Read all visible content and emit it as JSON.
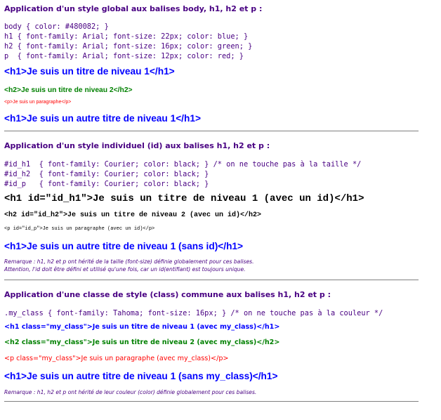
{
  "section1": {
    "title": "Application d'un style global aux balises body, h1, h2 et p :",
    "code": [
      "body { color: #480082; }",
      "h1 { font-family: Arial; font-size: 22px; color: blue; }",
      "h2 { font-family: Arial; font-size: 16px; color: green; }",
      "p  { font-family: Arial; font-size: 12px; color: red; }"
    ],
    "h1_demo": "<h1>Je suis un titre de niveau 1</h1>",
    "h2_demo": "<h2>Je suis un titre de niveau 2</h2>",
    "p_demo": "<p>Je suis un paragraphe</p>",
    "h1_demo2": "<h1>Je suis un autre titre de niveau 1</h1>"
  },
  "section2": {
    "title": "Application d'un style individuel (id) aux balises h1, h2 et p :",
    "code": [
      "#id_h1  { font-family: Courier; color: black; } /* on ne touche pas à la taille */",
      "#id_h2  { font-family: Courier; color: black; }",
      "#id_p   { font-family: Courier; color: black; }"
    ],
    "h1_demo": "<h1 id=\"id_h1\">Je suis un titre de niveau 1 (avec un id)</h1>",
    "h2_demo": "<h2 id=\"id_h2\">Je suis un titre de niveau 2 (avec un id)</h2>",
    "p_demo": "<p id=\"id_p\">Je suis un paragraphe (avec un id)</p>",
    "h1_demo2": "<h1>Je suis un autre titre de niveau 1 (sans id)</h1>",
    "remark_lines": [
      "Remarque : h1, h2 et p ont hérité de la taille (font-size) définie globalement pour ces balises.",
      "Attention, l'id doit être défini et utilisé qu'une fois, car un id(entifiant) est toujours unique."
    ]
  },
  "section3": {
    "title": "Application d'une classe de style (class) commune aux balises h1, h2 et p :",
    "code": [
      ".my_class { font-family: Tahoma; font-size: 16px; } /* on ne touche pas à la couleur */"
    ],
    "h1_demo": "<h1 class=\"my_class\">Je suis un titre de niveau 1 (avec my_class)</h1>",
    "h2_demo": "<h2 class=\"my_class\">Je suis un titre de niveau 2 (avec my_class)</h2>",
    "p_demo": "<p class=\"my_class\">Je suis un paragraphe (avec my_class)</p>",
    "h1_demo2": "<h1>Je suis un autre titre de niveau 1 (sans my_class)</h1>",
    "remark_lines": [
      "Remarque : h1, h2 et p ont hérité de leur couleur (color) définie globalement pour ces balises."
    ]
  },
  "colors": {
    "body_text": "#480082",
    "h1": "#0000ff",
    "h2": "#008000",
    "p": "#ff0000",
    "id_text": "#000000",
    "separator": "#808080"
  }
}
